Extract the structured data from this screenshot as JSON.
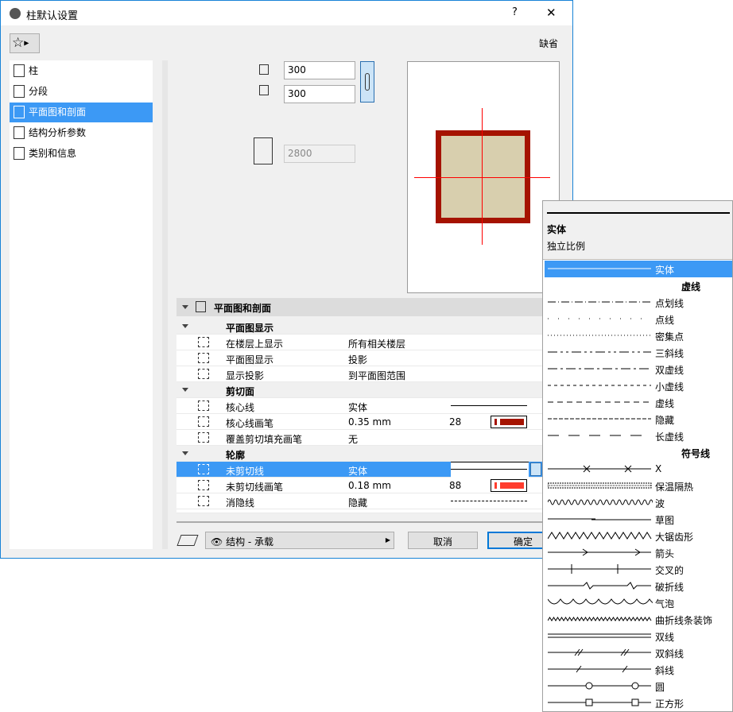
{
  "window": {
    "title": "柱默认设置",
    "help": "?",
    "close": "✕",
    "default_label": "缺省"
  },
  "nav": [
    {
      "label": "柱",
      "icon": "column-icon"
    },
    {
      "label": "分段",
      "icon": "segment-icon"
    },
    {
      "label": "平面图和剖面",
      "icon": "floor-plan-icon",
      "selected": true
    },
    {
      "label": "结构分析参数",
      "icon": "structural-icon"
    },
    {
      "label": "类别和信息",
      "icon": "info-icon"
    }
  ],
  "size": {
    "width": "300",
    "depth": "300",
    "height": "2800"
  },
  "section": {
    "title": "平面图和剖面",
    "rows": [
      {
        "type": "group",
        "label": "平面图显示"
      },
      {
        "label": "在楼层上显示",
        "value": "所有相关楼层",
        "icon": "story-icon"
      },
      {
        "label": "平面图显示",
        "value": "投影",
        "icon": "projection-icon"
      },
      {
        "label": "显示投影",
        "value": "到平面图范围",
        "icon": "range-icon"
      },
      {
        "type": "group",
        "label": "剪切面"
      },
      {
        "label": "核心线",
        "value": "实体",
        "line": "solid",
        "icon": "core-line-icon"
      },
      {
        "label": "核心线画笔",
        "value": "0.35 mm",
        "num": "28",
        "pen": "#a51300",
        "icon": "core-pen-icon"
      },
      {
        "label": "覆盖剪切填充画笔",
        "value": "无",
        "icon": "override-pen-icon"
      },
      {
        "type": "group",
        "label": "轮廓"
      },
      {
        "label": "未剪切线",
        "value": "实体",
        "line": "solid",
        "selected": true,
        "icon": "uncut-line-icon"
      },
      {
        "label": "未剪切线画笔",
        "value": "0.18 mm",
        "num": "88",
        "pen": "#ff3d2e",
        "icon": "uncut-pen-icon"
      },
      {
        "label": "消隐线",
        "value": "隐藏",
        "line": "dashed",
        "icon": "hidden-line-icon"
      }
    ]
  },
  "footer": {
    "layer": "结构 - 承载",
    "cancel": "取消",
    "ok": "确定"
  },
  "popup": {
    "current": "实体",
    "scale": "独立比例",
    "items": [
      {
        "label": "实体",
        "style": "solid",
        "selected": true
      },
      {
        "label": "虚线",
        "header": true
      },
      {
        "label": "点划线",
        "style": "dashdot"
      },
      {
        "label": "点线",
        "style": "dots"
      },
      {
        "label": "密集点",
        "style": "densedots"
      },
      {
        "label": "三斜线",
        "style": "triple"
      },
      {
        "label": "双虚线",
        "style": "double"
      },
      {
        "label": "小虚线",
        "style": "smalldash"
      },
      {
        "label": "虚线",
        "style": "dash"
      },
      {
        "label": "隐藏",
        "style": "hidden"
      },
      {
        "label": "长虚线",
        "style": "longdash"
      },
      {
        "label": "符号线",
        "header": true
      },
      {
        "label": "X",
        "style": "x"
      },
      {
        "label": "保温隔热",
        "style": "insul"
      },
      {
        "label": "波",
        "style": "wave"
      },
      {
        "label": "草图",
        "style": "sketch"
      },
      {
        "label": "大锯齿形",
        "style": "zigzag"
      },
      {
        "label": "箭头",
        "style": "arrow"
      },
      {
        "label": "交叉的",
        "style": "cross"
      },
      {
        "label": "破折线",
        "style": "break"
      },
      {
        "label": "气泡",
        "style": "bubble"
      },
      {
        "label": "曲折线条装饰",
        "style": "smallzig"
      },
      {
        "label": "双线",
        "style": "dbl"
      },
      {
        "label": "双斜线",
        "style": "dblslash"
      },
      {
        "label": "斜线",
        "style": "slash"
      },
      {
        "label": "圆",
        "style": "circle"
      },
      {
        "label": "正方形",
        "style": "square"
      }
    ]
  },
  "colors": {
    "accent": "#3c99f5",
    "cut": "#a51300",
    "fill": "#d8cfae"
  }
}
